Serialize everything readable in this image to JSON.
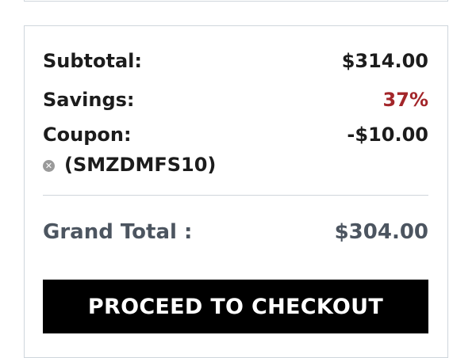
{
  "summary": {
    "subtotal": {
      "label": "Subtotal:",
      "value": "$314.00"
    },
    "savings": {
      "label": "Savings:",
      "value": "37%",
      "value_color": "#a3262a"
    },
    "coupon": {
      "label": "Coupon:",
      "value": "-$10.00",
      "code": "(SMZDMFS10)",
      "remove_icon": "close-circle-icon"
    },
    "grand_total": {
      "label": "Grand Total :",
      "value": "$304.00"
    }
  },
  "actions": {
    "checkout_label": "PROCEED TO CHECKOUT"
  }
}
